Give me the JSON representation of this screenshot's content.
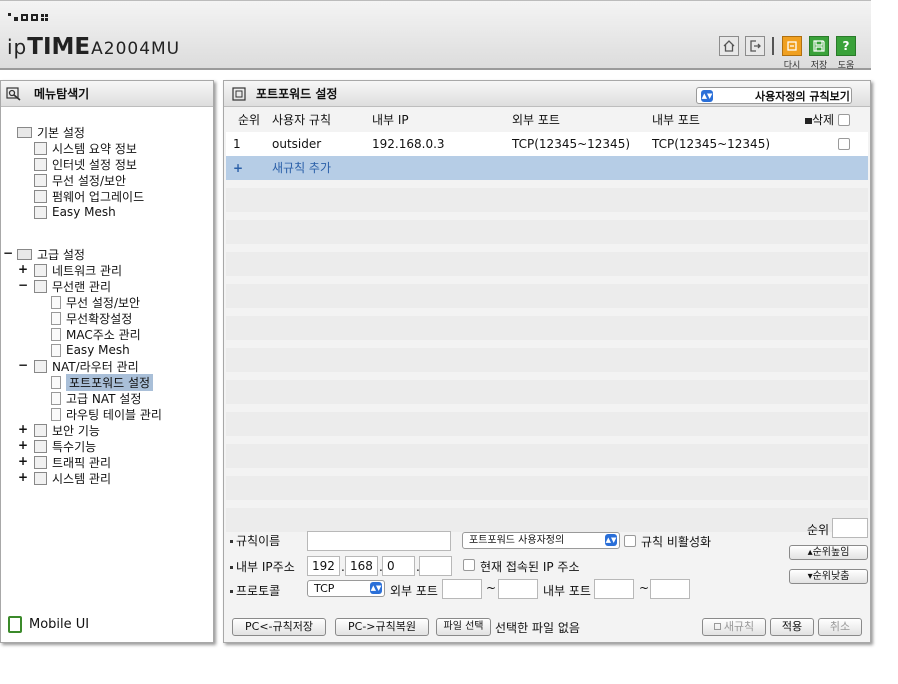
{
  "header": {
    "brand_ip": "ip",
    "brand_time": "TIME",
    "brand_model": "A2004MU",
    "buttons": {
      "retry_label": "다시",
      "save_label": "저장",
      "help_label": "도움"
    }
  },
  "left_panel": {
    "title": "메뉴탐색기",
    "basic": {
      "label": "기본 설정",
      "items": [
        "시스템 요약 정보",
        "인터넷 설정 정보",
        "무선 설정/보안",
        "펌웨어 업그레이드",
        "Easy Mesh"
      ]
    },
    "advanced": {
      "toggle": "−",
      "label": "고급 설정",
      "network": "네트워크 관리",
      "wireless": "무선랜 관리",
      "wireless_items": [
        "무선 설정/보안",
        "무선확장설정",
        "MAC주소 관리",
        "Easy Mesh"
      ],
      "nat": "NAT/라우터 관리",
      "nat_items": [
        "포트포워드 설정",
        "고급 NAT 설정",
        "라우팅 테이블 관리"
      ],
      "security": "보안 기능",
      "special": "특수기능",
      "traffic": "트래픽 관리",
      "system": "시스템 관리"
    },
    "mobile_ui": "Mobile UI"
  },
  "right_panel": {
    "title": "포트포워드 설정",
    "view_select": "사용자정의 규칙보기",
    "columns": {
      "order": "순위",
      "rule": "사용자 규칙",
      "internal_ip": "내부 IP",
      "external_port": "외부 포트",
      "internal_port": "내부 포트",
      "delete": "삭제"
    },
    "rows": [
      {
        "order": "1",
        "rule": "outsider",
        "internal_ip": "192.168.0.3",
        "external_port": "TCP(12345~12345)",
        "internal_port": "TCP(12345~12345)"
      }
    ],
    "add_row": {
      "plus": "+",
      "label": "새규칙 추가"
    },
    "form": {
      "rule_name_label": "규칙이름",
      "rule_name_value": "",
      "preset_select": "포트포워드 사용자정의",
      "disable_label": "규칙 비활성화",
      "order_label": "순위",
      "order_value": "",
      "ip_label": "내부 IP주소",
      "ip": [
        "192",
        "168",
        "0",
        ""
      ],
      "current_ip_label": "현재 접속된 IP 주소",
      "protocol_label": "프로토콜",
      "protocol_value": "TCP",
      "ext_port_label": "외부 포트",
      "int_port_label": "내부 포트",
      "tilde": "~",
      "order_up": "▴순위높임",
      "order_down": "▾순위낮춤"
    },
    "bottom": {
      "pc_save": "PC<-규칙저장",
      "pc_restore": "PC->규칙복원",
      "file_select": "파일 선택",
      "no_file": "선택한 파일 없음",
      "new_rule": "새규칙",
      "apply": "적용",
      "cancel": "취소"
    }
  }
}
